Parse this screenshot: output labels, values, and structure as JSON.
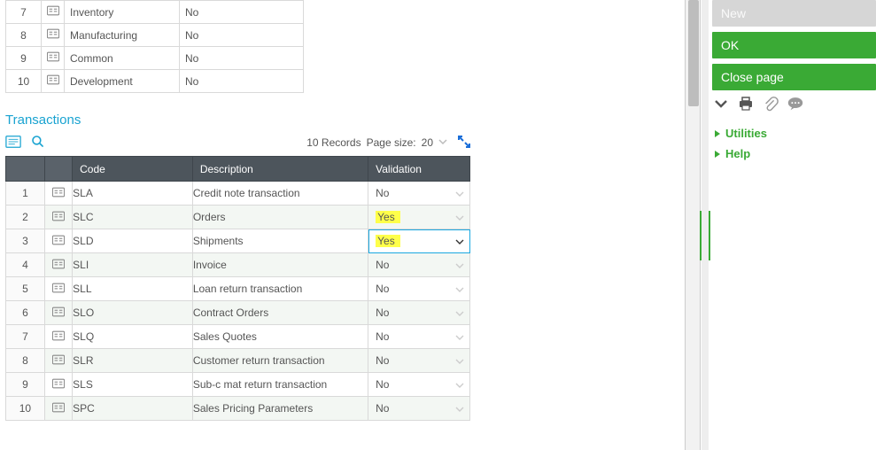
{
  "top_rows": [
    {
      "idx": "7",
      "name": "Inventory",
      "flag": "No"
    },
    {
      "idx": "8",
      "name": "Manufacturing",
      "flag": "No"
    },
    {
      "idx": "9",
      "name": "Common",
      "flag": "No"
    },
    {
      "idx": "10",
      "name": "Development",
      "flag": "No"
    }
  ],
  "section_title": "Transactions",
  "toolbar": {
    "records": "10 Records",
    "page_size_label": "Page size:",
    "page_size_value": "20"
  },
  "tx_headers": {
    "code": "Code",
    "description": "Description",
    "validation": "Validation"
  },
  "tx_rows": [
    {
      "idx": "1",
      "code": "SLA",
      "desc": "Credit note transaction",
      "val": "No",
      "hl": false,
      "sel": false
    },
    {
      "idx": "2",
      "code": "SLC",
      "desc": "Orders",
      "val": "Yes",
      "hl": true,
      "sel": false
    },
    {
      "idx": "3",
      "code": "SLD",
      "desc": "Shipments",
      "val": "Yes",
      "hl": true,
      "sel": true
    },
    {
      "idx": "4",
      "code": "SLI",
      "desc": "Invoice",
      "val": "No",
      "hl": false,
      "sel": false
    },
    {
      "idx": "5",
      "code": "SLL",
      "desc": "Loan return transaction",
      "val": "No",
      "hl": false,
      "sel": false
    },
    {
      "idx": "6",
      "code": "SLO",
      "desc": "Contract Orders",
      "val": "No",
      "hl": false,
      "sel": false
    },
    {
      "idx": "7",
      "code": "SLQ",
      "desc": "Sales Quotes",
      "val": "No",
      "hl": false,
      "sel": false
    },
    {
      "idx": "8",
      "code": "SLR",
      "desc": "Customer return transaction",
      "val": "No",
      "hl": false,
      "sel": false
    },
    {
      "idx": "9",
      "code": "SLS",
      "desc": "Sub-c mat return transaction",
      "val": "No",
      "hl": false,
      "sel": false
    },
    {
      "idx": "10",
      "code": "SPC",
      "desc": "Sales Pricing Parameters",
      "val": "No",
      "hl": false,
      "sel": false
    }
  ],
  "panel": {
    "new_btn": "New",
    "ok_btn": "OK",
    "close_btn": "Close page",
    "utilities": "Utilities",
    "help": "Help"
  }
}
